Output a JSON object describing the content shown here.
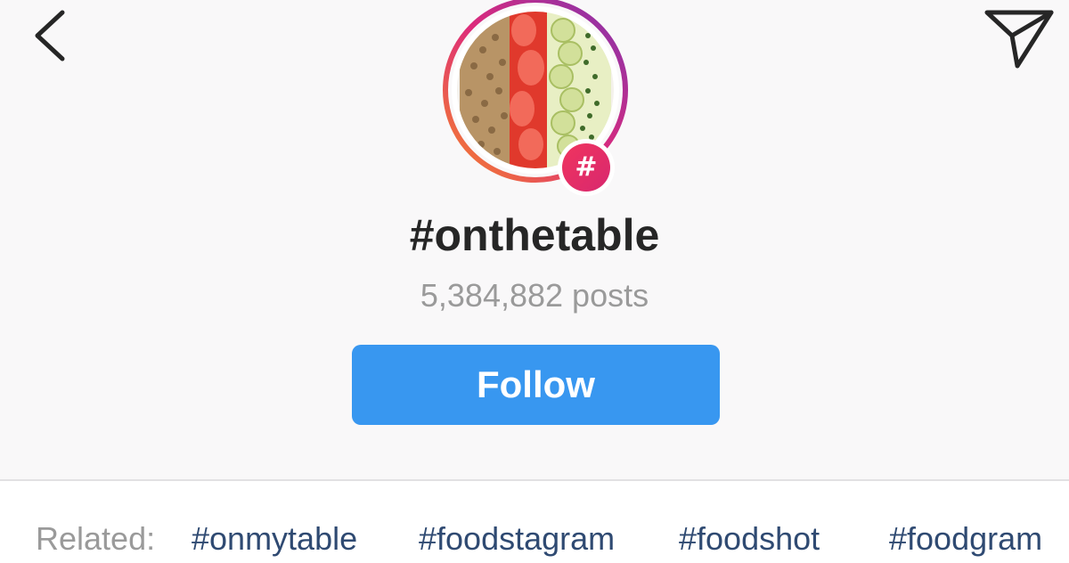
{
  "header": {
    "back_icon": "chevron-left-icon",
    "share_icon": "paper-plane-icon"
  },
  "profile": {
    "avatar": "food-plate-photo",
    "badge_symbol": "#",
    "hashtag": "#onthetable",
    "post_count": "5,384,882 posts"
  },
  "follow_button": {
    "label": "Follow",
    "color": "#3897f0"
  },
  "related": {
    "label": "Related:",
    "tags": [
      "#onmytable",
      "#foodstagram",
      "#foodshot",
      "#foodgram"
    ]
  },
  "colors": {
    "story_ring_start": "#f58529",
    "story_ring_end": "#c13584",
    "tag_link": "#2f4a72"
  }
}
